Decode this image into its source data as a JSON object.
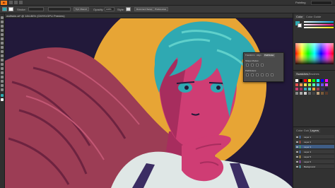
{
  "app": {
    "logo": "Ai",
    "workspace": "Painting"
  },
  "control_bar": {
    "stroke_label": "Stroke:",
    "brush_label": "5 pt. Round",
    "opacity_label": "Opacity:",
    "opacity_value": "100%",
    "style_label": "Style:",
    "doc_setup": "Document Setup",
    "preferences": "Preferences"
  },
  "document": {
    "tab_label": "wolfskin.ai* @ 184.86% (CMYK/GPU Preview)",
    "close": "×"
  },
  "right_panel": {
    "color_tabs": [
      "Color",
      "Color Guide"
    ],
    "swatch_tabs": [
      "Swatches",
      "Brushes"
    ],
    "layer_tabs": [
      "Color Guide",
      "Layers"
    ],
    "layers": [
      {
        "name": "Layer 1",
        "selected": false
      },
      {
        "name": "Layer 2",
        "selected": false
      },
      {
        "name": "Layer 3",
        "selected": true
      },
      {
        "name": "Layer 4",
        "selected": false
      },
      {
        "name": "Layer 5",
        "selected": false
      },
      {
        "name": "Layer 6",
        "selected": false
      },
      {
        "name": "Background",
        "selected": false
      }
    ]
  },
  "float_panel": {
    "tabs": [
      "Transform",
      "Align",
      "Pathfinder"
    ],
    "shape_modes_label": "Shape Modes:",
    "pathfinders_label": "Pathfinders:"
  },
  "colors": {
    "bg_navy": "#22193a",
    "moon": "#e7a535",
    "skin": "#cf3d74",
    "skin_shadow": "#a72d5e",
    "hair": "#2fa9b2",
    "hair_light": "#5fd0cb",
    "wing": "#9c3d55",
    "shirt": "#dfe7e6",
    "suspender": "#3b2d63"
  }
}
